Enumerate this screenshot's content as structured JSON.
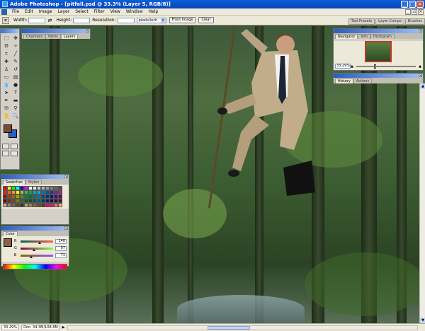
{
  "window": {
    "title": "Adobe Photoshop - [pitfall.psd @ 33.3% (Layer 5, RGB/8)]",
    "minimize_label": "_",
    "maximize_label": "□",
    "close_label": "×"
  },
  "menu": [
    "File",
    "Edit",
    "Image",
    "Layer",
    "Select",
    "Filter",
    "View",
    "Window",
    "Help"
  ],
  "options_bar": {
    "width_label": "Width:",
    "height_label": "Height:",
    "resolution_label": "Resolution:",
    "resolution_unit": "pixels/inch",
    "front_image_label": "Front Image",
    "clear_label": "Clear"
  },
  "palette_well": [
    "Tool Presets",
    "Layer Comps",
    "Brushes"
  ],
  "layers_palette": {
    "tabs": [
      "Channels",
      "Paths",
      "Layers"
    ]
  },
  "swatches_palette": {
    "tabs": [
      "Swatches",
      "Styles"
    ],
    "colors": [
      "#ff0000",
      "#ffff00",
      "#00ff00",
      "#00ffff",
      "#0000ff",
      "#ff00ff",
      "#ffffff",
      "#e6e6e6",
      "#cccccc",
      "#b3b3b3",
      "#999999",
      "#808080",
      "#666666",
      "#4d4d4d",
      "#ed1c24",
      "#f26522",
      "#f7941d",
      "#fff200",
      "#8dc63f",
      "#39b54a",
      "#00a651",
      "#00a99d",
      "#00aeef",
      "#0072bc",
      "#0054a6",
      "#2e3192",
      "#662d91",
      "#92278f",
      "#9e0b0f",
      "#a0410d",
      "#a36209",
      "#aba000",
      "#598527",
      "#1a7b30",
      "#007236",
      "#00746b",
      "#0076a3",
      "#004b80",
      "#003471",
      "#1b1464",
      "#440e62",
      "#630460",
      "#790000",
      "#7b2e00",
      "#7d4900",
      "#827b00",
      "#406618",
      "#005e20",
      "#005826",
      "#005952",
      "#005b7f",
      "#003663",
      "#002157",
      "#0d004c",
      "#32004b",
      "#4b0049",
      "#c7b299",
      "#998675",
      "#736357",
      "#534741",
      "#37302a",
      "#c69c6d",
      "#a67c52",
      "#8c6239",
      "#754c24",
      "#603913",
      "#ec008c",
      "#ed145b",
      "#f26d7d",
      "#fbaf5d"
    ]
  },
  "color_palette": {
    "tab": "Color",
    "foreground": "#8c5f4a",
    "channels": [
      {
        "name": "R",
        "value": "140",
        "fraction": 0.55
      },
      {
        "name": "G",
        "value": "97",
        "fraction": 0.38
      },
      {
        "name": "B",
        "value": "71",
        "fraction": 0.28
      }
    ]
  },
  "navigator_palette": {
    "tabs": [
      "Navigator",
      "Info",
      "Histogram"
    ],
    "zoom": "33.29%"
  },
  "history_palette": {
    "tabs": [
      "History",
      "Actions"
    ]
  },
  "status": {
    "zoom": "33.29%",
    "doc": "Doc: 34.3M/108.8M"
  },
  "colors": {
    "foreground": "#7a4b3a",
    "background": "#2c5dc8"
  }
}
